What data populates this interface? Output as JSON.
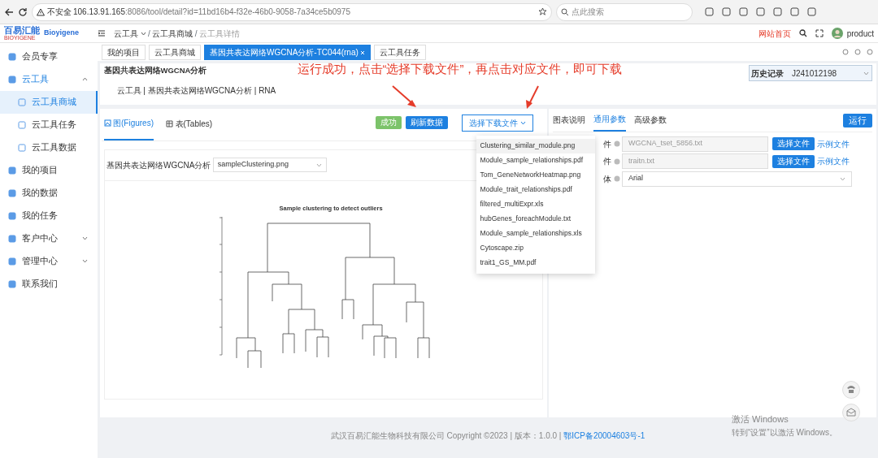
{
  "browser": {
    "security": "不安全",
    "url_host": "106.13.91.165",
    "url_rest": ":8086/tool/detail?id=11bd16b4-f32e-46b0-9058-7a34ce5b0975",
    "search_placeholder": "点此搜索"
  },
  "header": {
    "logo_cn": "百易汇能",
    "logo_sub": "BIOYIGENE",
    "logo_en": "Bioyigene",
    "breadcrumb": [
      "云工具",
      "云工具商城",
      "云工具详情"
    ],
    "breadcrumb_separator": "/",
    "home_link": "网站首页",
    "user": "product"
  },
  "tabs": [
    {
      "label": "我的项目",
      "selected": false,
      "closable": false
    },
    {
      "label": "云工具商城",
      "selected": false,
      "closable": false
    },
    {
      "label": "基因共表达网络WGCNA分析-TC044(rna)",
      "selected": true,
      "closable": true
    },
    {
      "label": "云工具任务",
      "selected": false,
      "closable": false
    }
  ],
  "sidebar": {
    "items": [
      {
        "kind": "link",
        "label": "会员专享",
        "selected": false
      },
      {
        "kind": "group",
        "label": "云工具",
        "expanded": true,
        "selected": false,
        "children": [
          {
            "label": "云工具商城",
            "selected": true
          },
          {
            "label": "云工具任务",
            "selected": false
          },
          {
            "label": "云工具数据",
            "selected": false
          }
        ]
      },
      {
        "kind": "link",
        "label": "我的项目",
        "selected": false
      },
      {
        "kind": "link",
        "label": "我的数据",
        "selected": false
      },
      {
        "kind": "link",
        "label": "我的任务",
        "selected": false
      },
      {
        "kind": "group",
        "label": "客户中心",
        "expanded": false,
        "selected": false
      },
      {
        "kind": "group",
        "label": "管理中心",
        "expanded": false,
        "selected": false
      },
      {
        "kind": "link",
        "label": "联系我们",
        "selected": false
      }
    ]
  },
  "tool": {
    "title": "基因共表达网络WGCNA分析",
    "subtitle": "云工具 | 基因共表达网络WGCNA分析 | RNA",
    "history_label": "历史记录",
    "history_value": "J241012198"
  },
  "annotation": "运行成功，点击“选择下载文件”，再点击对应文件，即可下载",
  "results": {
    "view_tabs": [
      {
        "label": "图(Figures)",
        "selected": true
      },
      {
        "label": "表(Tables)",
        "selected": false
      }
    ],
    "status": "成功",
    "refresh": "刷新数据",
    "download": "选择下载文件",
    "download_menu": [
      {
        "label": "Clustering_similar_module.png",
        "selected": true
      },
      {
        "label": "Module_sample_relationships.pdf",
        "selected": false
      },
      {
        "label": "Tom_GeneNetworkHeatmap.png",
        "selected": false
      },
      {
        "label": "Module_trait_relationships.pdf",
        "selected": false
      },
      {
        "label": "filtered_multiExpr.xls",
        "selected": false
      },
      {
        "label": "hubGenes_foreachModule.txt",
        "selected": false
      },
      {
        "label": "Module_sample_relationships.xls",
        "selected": false
      },
      {
        "label": "Cytoscape.zip",
        "selected": false
      },
      {
        "label": "trait1_GS_MM.pdf",
        "selected": false
      }
    ],
    "figure_label": "基因共表达网络WGCNA分析",
    "figure_select": "sampleClustering.png",
    "plot_title": "Sample clustering to detect outliers"
  },
  "params": {
    "tabs": [
      {
        "label": "图表说明",
        "selected": false
      },
      {
        "label": "通用参数",
        "selected": true
      },
      {
        "label": "高级参数",
        "selected": false
      }
    ],
    "run": "运行",
    "rows": [
      {
        "kind": "file",
        "label": "件",
        "value": "WGCNA_tset_5856.txt",
        "button": "选择文件",
        "example": "示例文件"
      },
      {
        "kind": "file",
        "label": "件",
        "value": "traitn.txt",
        "button": "选择文件",
        "example": "示例文件"
      },
      {
        "kind": "select",
        "label": "体",
        "value": "Arial"
      }
    ]
  },
  "footer": {
    "text": "武汉百易汇能生物科技有限公司 Copyright ©2023 | 版本：1.0.0 | ",
    "icp": "鄂ICP备20004603号-1"
  },
  "os_notice": {
    "title": "激活 Windows",
    "text": "转到“设置”以激活 Windows。"
  }
}
